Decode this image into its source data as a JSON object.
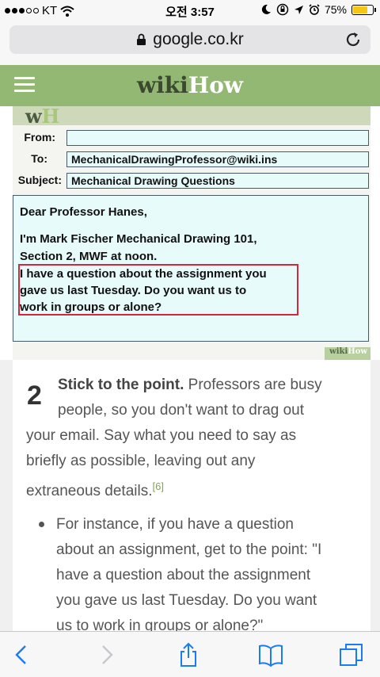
{
  "status_bar": {
    "carrier": "KT",
    "time": "오전 3:57",
    "battery": "75%",
    "battery_level": 0.75
  },
  "browser": {
    "url": "google.co.kr"
  },
  "header": {
    "logo_wiki": "wiki",
    "logo_how": "How"
  },
  "illustration": {
    "mark_w": "w",
    "mark_h": "H",
    "from_label": "From:",
    "from_value": "",
    "to_label": "To:",
    "to_value": "MechanicalDrawingProfessor@wiki.ins",
    "subject_label": "Subject:",
    "subject_value": "Mechanical Drawing Questions",
    "greeting": "Dear Professor Hanes,",
    "line1": "I'm Mark Fischer Mechanical Drawing 101,",
    "line2": "Section 2, MWF at noon.",
    "hl1": "I have a question about the assignment you",
    "hl2": "gave us last Tuesday. Do you want us to",
    "hl3": "work in groups or alone?",
    "badge_wiki": "wiki",
    "badge_how": "How"
  },
  "article": {
    "step_number": "2",
    "step_title": "Stick to the point.",
    "step_line1": " Professors are busy",
    "step_line2": "people, so you don't want to drag out",
    "step_line3": "your email. Say what you need to say as",
    "step_line4": "briefly as possible, leaving out any",
    "step_line5": "extraneous details.",
    "ref": "[6]",
    "bullet_line1": "For instance, if you have a question",
    "bullet_line2": "about an assignment, get to the point: \"I",
    "bullet_line3": "have a question about the assignment",
    "bullet_line4": "you gave us last Tuesday. Do you want",
    "bullet_line5": "us to work in groups or alone?\""
  },
  "colors": {
    "header_green": "#93b874",
    "ios_blue": "#1a7cf5",
    "highlight_red": "#d6263a"
  },
  "icons": [
    "signal-dots-icon",
    "wifi-icon",
    "moon-icon",
    "rotation-lock-icon",
    "location-icon",
    "alarm-icon",
    "battery-icon",
    "lock-icon",
    "reload-icon",
    "hamburger-icon",
    "back-icon",
    "forward-icon",
    "share-icon",
    "bookmarks-icon",
    "tabs-icon"
  ]
}
